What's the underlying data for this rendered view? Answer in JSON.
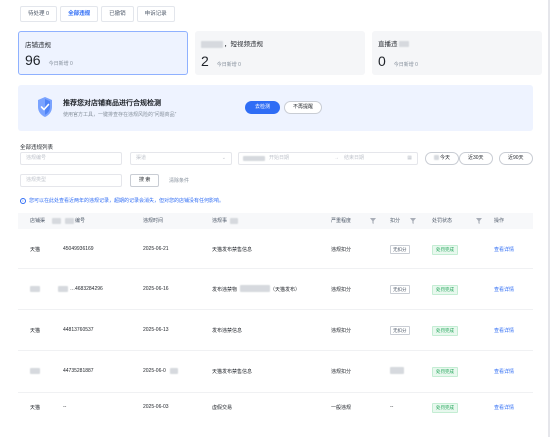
{
  "tabs": [
    {
      "label": "待处理 0",
      "active": false
    },
    {
      "label": "全部违规",
      "active": true
    },
    {
      "label": "已撤销",
      "active": false
    },
    {
      "label": "申诉记录",
      "active": false
    }
  ],
  "cards": [
    {
      "title": "店铺违规",
      "count": "96",
      "today": "今日新增 0"
    },
    {
      "title": "，短视频违规",
      "count": "2",
      "today": "今日新增 0"
    },
    {
      "title": "直播违",
      "count": "0",
      "today": "今日新增 0"
    }
  ],
  "banner": {
    "title": "推荐您对店铺商品进行合规检测",
    "desc": "使用官方工具，一键排查存在违规风险的“问题商品”",
    "primary": "去检测",
    "secondary": "不再提醒"
  },
  "filters": {
    "section_label": "全部违规列表",
    "violation_no": "违规编号",
    "platform": "渠道",
    "start_date": "开始日期",
    "to": "→",
    "end_date": "结束日期",
    "today": "今天",
    "last30": "近30天",
    "last90": "近90天",
    "violation_type": "违规类型",
    "search": "搜 索",
    "clear": "清除条件"
  },
  "note": "您可以在此处查看近两年的违规记录，超期的记录会消失，但对您的店铺没有任何影响。",
  "table": {
    "headers": {
      "channel": "店铺渠",
      "number": "编号",
      "time": "违规时间",
      "content": "违规事",
      "severity": "严重程度",
      "penalty": "扣分",
      "status": "处罚状态",
      "action": "操作"
    },
    "rows": [
      {
        "channel": "天猫",
        "number": "45049936169",
        "time": "2025-06-21",
        "content": "天猫发布禁售信息",
        "severity": "违规扣分",
        "penalty": "无扣分",
        "status": "处罚完成",
        "action": "查看详情"
      },
      {
        "channel": "",
        "number": "…4683284296",
        "time": "2025-06-16",
        "content": "发布违禁物",
        "content_extra": "（天猫发布）",
        "severity": "违规扣分",
        "penalty": "无扣分",
        "status": "处罚完成",
        "action": "查看详情"
      },
      {
        "channel": "天猫",
        "number": "44813760537",
        "time": "2025-06-13",
        "content": "发布违禁信息",
        "severity": "违规扣分",
        "penalty": "无扣分",
        "status": "处罚完成",
        "action": "查看详情"
      },
      {
        "channel": "",
        "number": "44735281887",
        "time": "2025-06-0",
        "content": "天猫发布禁售信息",
        "severity": "违规扣分",
        "penalty": "",
        "status": "处罚完成",
        "action": "查看详情"
      },
      {
        "channel": "天猫",
        "number": "--",
        "time": "2025-06-03",
        "content": "虚假交易",
        "severity": "一般违规",
        "penalty": "--",
        "status": "处罚完成",
        "action": "查看详情"
      }
    ]
  },
  "colors": {
    "accent": "#2f6df5",
    "success": "#23a55a",
    "banner_bg": "#eef3ff"
  }
}
